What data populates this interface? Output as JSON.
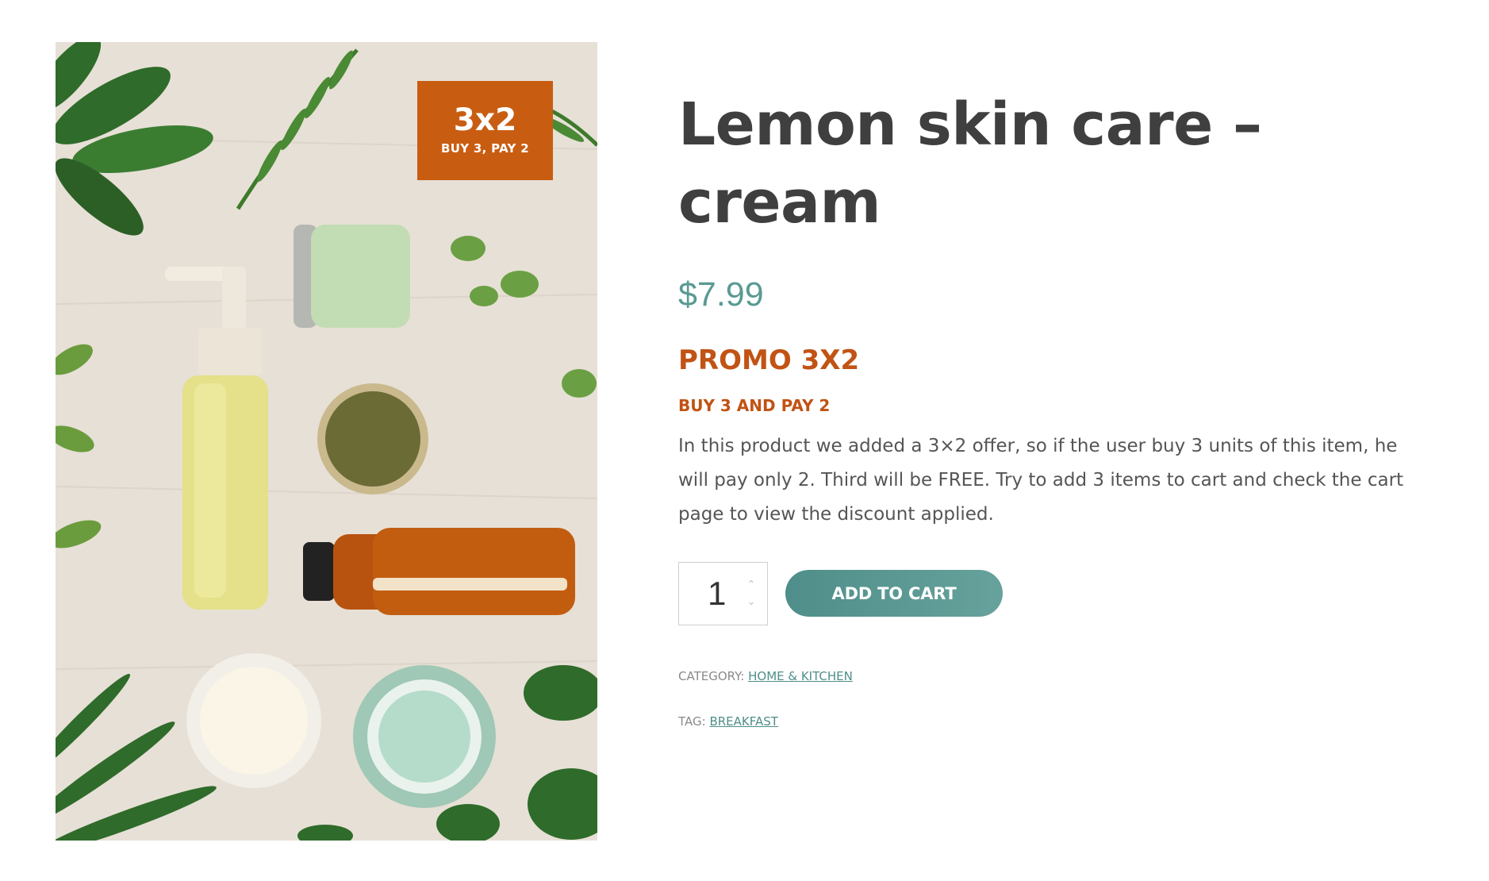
{
  "product": {
    "title": "Lemon skin care – cream",
    "price": "$7.99",
    "promo_heading": "PROMO 3X2",
    "promo_subheading": "BUY 3 AND PAY 2",
    "description": "In this product we added a 3×2 offer, so if the user buy 3 units of this item, he will pay only 2. Third will be FREE. Try to add 3 items to cart and check the cart page to view the discount applied.",
    "image_badge": {
      "main": "3x2",
      "sub": "BUY 3, PAY 2"
    }
  },
  "cart": {
    "quantity": "1",
    "up_icon": "chevron-up-icon",
    "down_icon": "chevron-down-icon",
    "add_to_cart_label": "ADD TO CART"
  },
  "meta": {
    "category_label": "CATEGORY:",
    "category_value": "HOME & KITCHEN",
    "tag_label": "TAG:",
    "tag_value": "BREAKFAST"
  },
  "colors": {
    "accent_teal": "#5a9a93",
    "promo_orange": "#c15314",
    "badge_orange": "#c85d12",
    "title_text": "#3f3f3f"
  }
}
